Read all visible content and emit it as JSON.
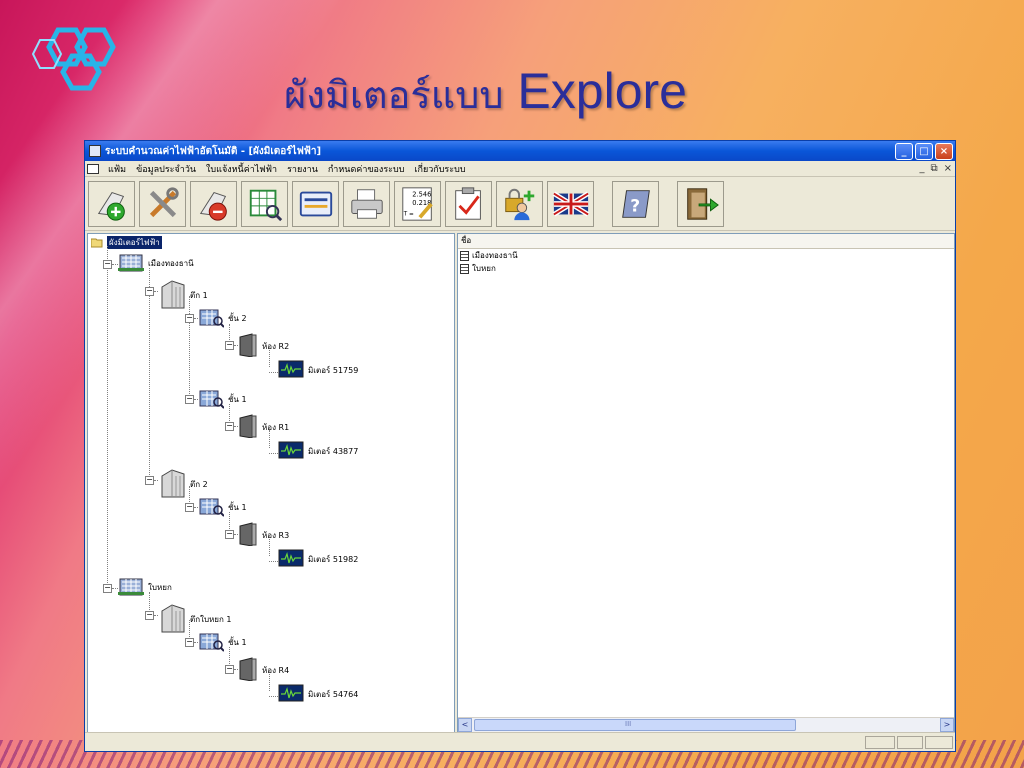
{
  "slide": {
    "title_thai": "ผังมิเตอร์แบบ",
    "title_en": "Explore"
  },
  "window": {
    "title": "ระบบคำนวณค่าไฟฟ้าอัตโนมัติ - [ผังมิเตอร์ไฟฟ้า]",
    "controls": {
      "minimize": "_",
      "maximize": "□",
      "close": "×"
    }
  },
  "menu": {
    "items": [
      "แฟ้ม",
      "ข้อมูลประจำวัน",
      "ใบแจ้งหนี้ค่าไฟฟ้า",
      "รายงาน",
      "กำหนดค่าของระบบ",
      "เกี่ยวกับระบบ"
    ],
    "mdi_controls": [
      "_",
      "⧉",
      "×"
    ]
  },
  "toolbar": {
    "buttons": [
      "add-meter-icon",
      "tools-icon",
      "remove-meter-icon",
      "table-search-icon",
      "form-icon",
      "printer-icon",
      "calculator-icon",
      "checklist-icon",
      "user-lock-icon",
      "uk-flag-icon",
      "help-icon",
      "exit-door-icon"
    ],
    "calc_values": [
      "2.546",
      "0.218",
      "T ="
    ]
  },
  "tree": {
    "root": "ผังมิเตอร์ไฟฟ้า",
    "nodes": [
      {
        "label": "เมืองทองธานี",
        "type": "site"
      },
      {
        "label": "ตึก 1",
        "type": "building"
      },
      {
        "label": "ชั้น 2",
        "type": "floor"
      },
      {
        "label": "ห้อง R2",
        "type": "room"
      },
      {
        "label": "มิเตอร์ 51759",
        "type": "meter"
      },
      {
        "label": "ชั้น 1",
        "type": "floor"
      },
      {
        "label": "ห้อง R1",
        "type": "room"
      },
      {
        "label": "มิเตอร์ 43877",
        "type": "meter"
      },
      {
        "label": "ตึก 2",
        "type": "building"
      },
      {
        "label": "ชั้น 1",
        "type": "floor"
      },
      {
        "label": "ห้อง R3",
        "type": "room"
      },
      {
        "label": "มิเตอร์ 51982",
        "type": "meter"
      },
      {
        "label": "ใบหยก",
        "type": "site"
      },
      {
        "label": "ตึกใบหยก 1",
        "type": "building"
      },
      {
        "label": "ชั้น 1",
        "type": "floor"
      },
      {
        "label": "ห้อง R4",
        "type": "room"
      },
      {
        "label": "มิเตอร์ 54764",
        "type": "meter"
      }
    ]
  },
  "list": {
    "header": "ชื่อ",
    "items": [
      "เมืองทองธานี",
      "ใบหยก"
    ],
    "scroll": {
      "left": "<",
      "right": ">",
      "thumb_grip": "III"
    }
  },
  "colors": {
    "slide_title": "#2a2e9a",
    "titlebar": "#0a56d8",
    "selection": "#0a246a"
  }
}
